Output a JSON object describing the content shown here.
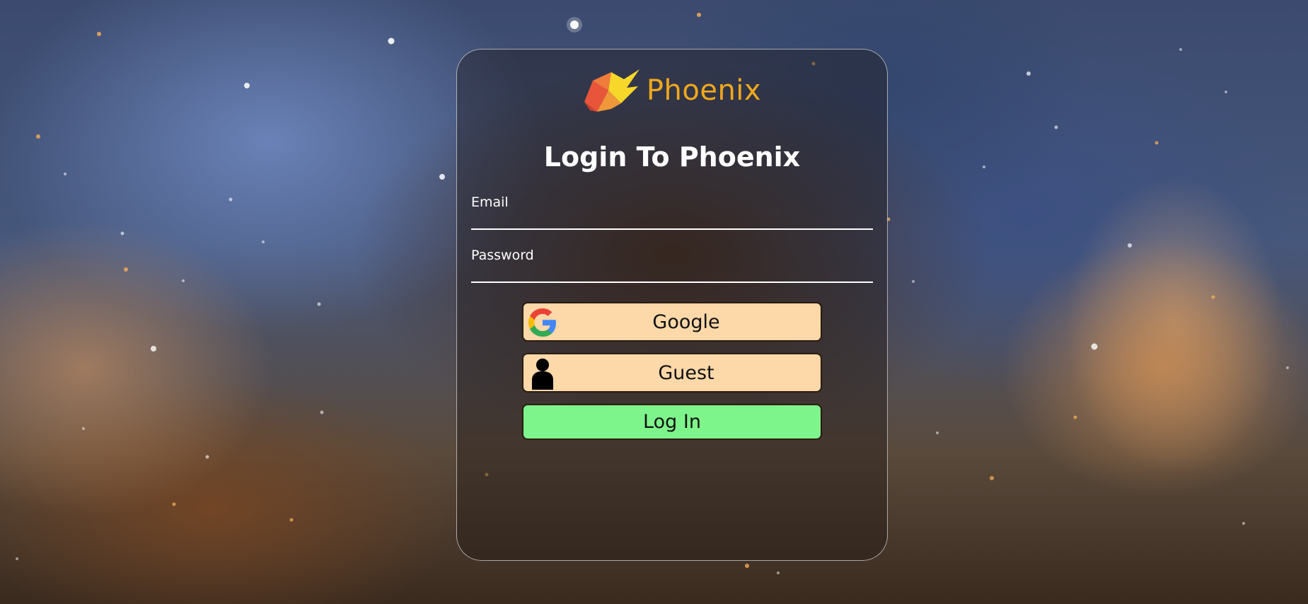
{
  "app": {
    "brand_name": "Phoenix",
    "brand_logo_icon": "phoenix-logo-icon",
    "brand_color": "#f0a81c"
  },
  "login": {
    "title": "Login To Phoenix",
    "email_label": "Email",
    "email_value": "",
    "password_label": "Password",
    "password_value": "",
    "google_button_label": "Google",
    "google_icon": "google-icon",
    "guest_button_label": "Guest",
    "guest_icon": "person-icon",
    "login_button_label": "Log In"
  },
  "colors": {
    "alt_button_bg": "#fdd8a8",
    "login_button_bg": "#7ef58a"
  }
}
